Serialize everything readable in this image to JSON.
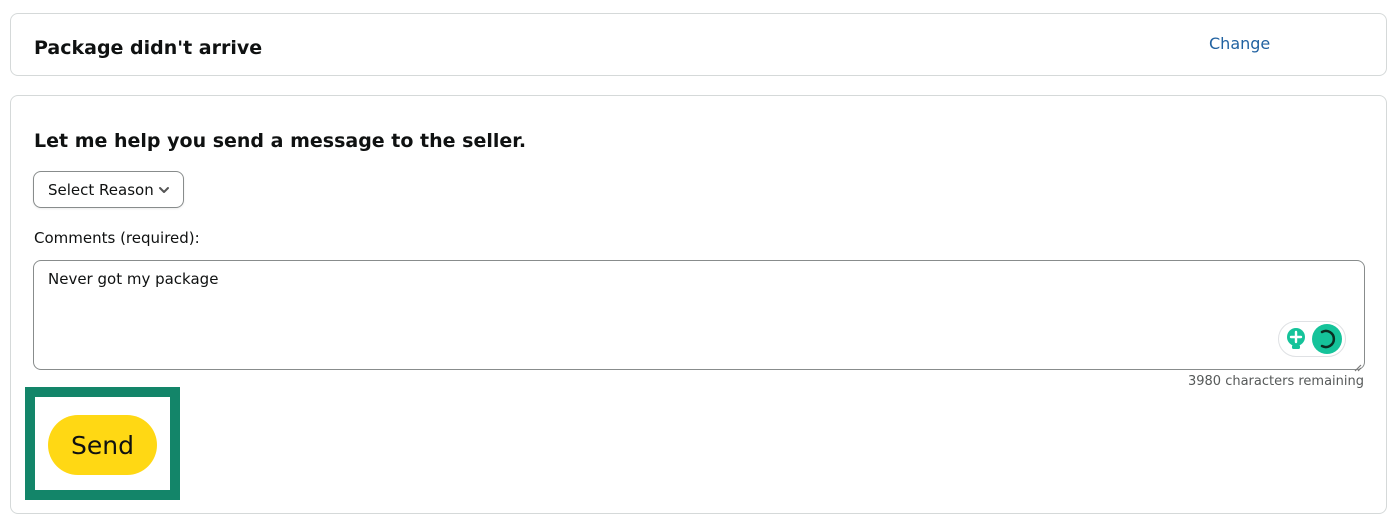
{
  "problem_card": {
    "title": "Package didn't arrive",
    "change_label": "Change"
  },
  "message_card": {
    "heading": "Let me help you send a message to the seller.",
    "reason_select": {
      "selected": "Select Reason",
      "icon": "chevron-down-icon"
    },
    "comments_label": "Comments (required):",
    "comments_value": "Never got my package",
    "characters_remaining": "3980 characters remaining",
    "send_label": "Send"
  },
  "colors": {
    "link": "#2162a1",
    "send_button": "#ffd814",
    "highlight_border": "#138569",
    "grammarly": "#15c39a"
  }
}
